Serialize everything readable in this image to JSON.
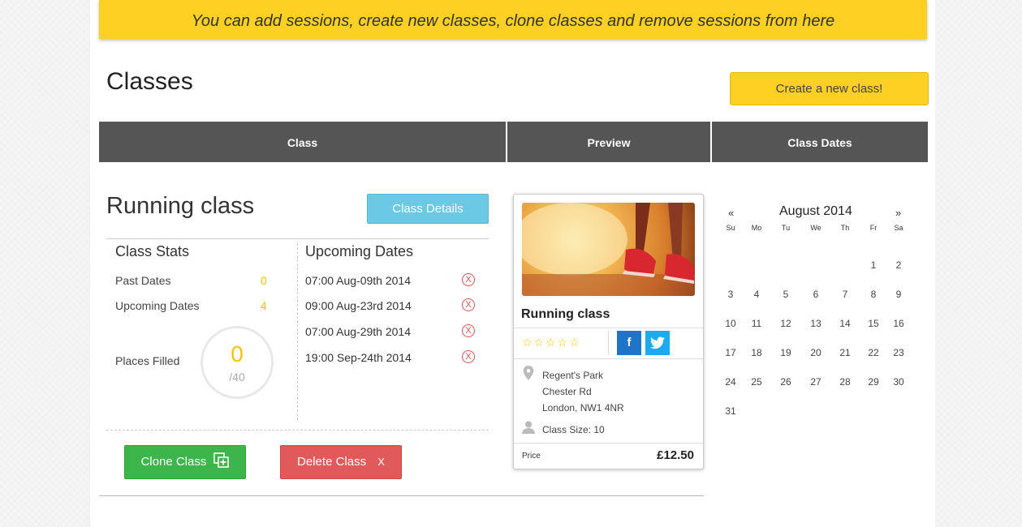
{
  "banner": {
    "text": "You can add sessions, create new classes, clone classes and remove sessions from here"
  },
  "page": {
    "title": "Classes",
    "create_button": "Create a new class!"
  },
  "tabs": [
    {
      "label": "Class"
    },
    {
      "label": "Preview"
    },
    {
      "label": "Class Dates"
    }
  ],
  "class_panel": {
    "name": "Running class",
    "details_button": "Class Details",
    "stats_title": "Class Stats",
    "stats": [
      {
        "label": "Past Dates",
        "value": "0"
      },
      {
        "label": "Upcoming Dates",
        "value": "4"
      }
    ],
    "places_label": "Places Filled",
    "places_filled": "0",
    "places_total": "/40",
    "upcoming_title": "Upcoming Dates",
    "upcoming": [
      "07:00 Aug-09th 2014",
      "09:00 Aug-23rd 2014",
      "07:00 Aug-29th 2014",
      "19:00 Sep-24th 2014"
    ],
    "remove_glyph": "X",
    "clone_button": "Clone Class",
    "delete_button": "Delete Class",
    "delete_glyph": "X"
  },
  "preview": {
    "title": "Running class",
    "stars": "☆☆☆☆☆",
    "rating": 0,
    "facebook_glyph": "f",
    "address_line1": "Regent's Park",
    "address_line2": "Chester Rd",
    "address_line3": "London, NW1 4NR",
    "class_size": "Class Size: 10",
    "price_label": "Price",
    "price": "£12.50"
  },
  "calendar": {
    "month": "August 2014",
    "prev": "«",
    "next": "»",
    "days_of_week": [
      "Su",
      "Mo",
      "Tu",
      "We",
      "Th",
      "Fr",
      "Sa"
    ],
    "first_weekday": 5,
    "days_in_month": 31
  },
  "colors": {
    "accent": "#fdd023",
    "tabbar": "#555555",
    "info": "#6bc9e6",
    "success": "#3cb64a",
    "danger": "#e05a5a"
  }
}
